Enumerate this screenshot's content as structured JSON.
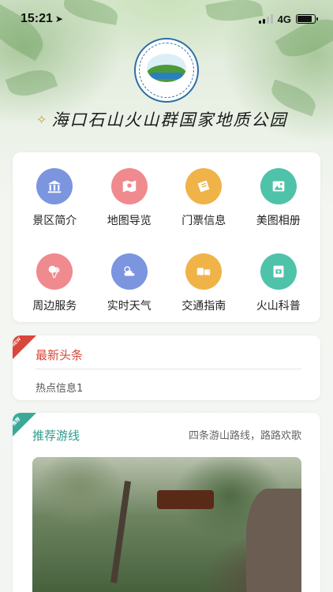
{
  "status": {
    "time": "15:21",
    "network": "4G"
  },
  "header": {
    "title": "海口石山火山群国家地质公园"
  },
  "colors": {
    "news_accent": "#d9463a",
    "route_accent": "#2e9c8c"
  },
  "grid": [
    {
      "label": "景区简介",
      "icon": "building-icon",
      "color": "#7b95df"
    },
    {
      "label": "地图导览",
      "icon": "map-icon",
      "color": "#ef8a8e"
    },
    {
      "label": "门票信息",
      "icon": "ticket-icon",
      "color": "#f0b348"
    },
    {
      "label": "美图相册",
      "icon": "photo-icon",
      "color": "#4fc3a9"
    },
    {
      "label": "周边服务",
      "icon": "balloon-icon",
      "color": "#ef8a8e"
    },
    {
      "label": "实时天气",
      "icon": "weather-icon",
      "color": "#7b95df"
    },
    {
      "label": "交通指南",
      "icon": "bus-icon",
      "color": "#f0b348"
    },
    {
      "label": "火山科普",
      "icon": "book-icon",
      "color": "#4fc3a9"
    }
  ],
  "news": {
    "badge": "NEW",
    "title": "最新头条",
    "item": "热点信息1"
  },
  "route": {
    "badge": "推荐",
    "title": "推荐游线",
    "subtitle": "四条游山路线，路路欢歌"
  }
}
